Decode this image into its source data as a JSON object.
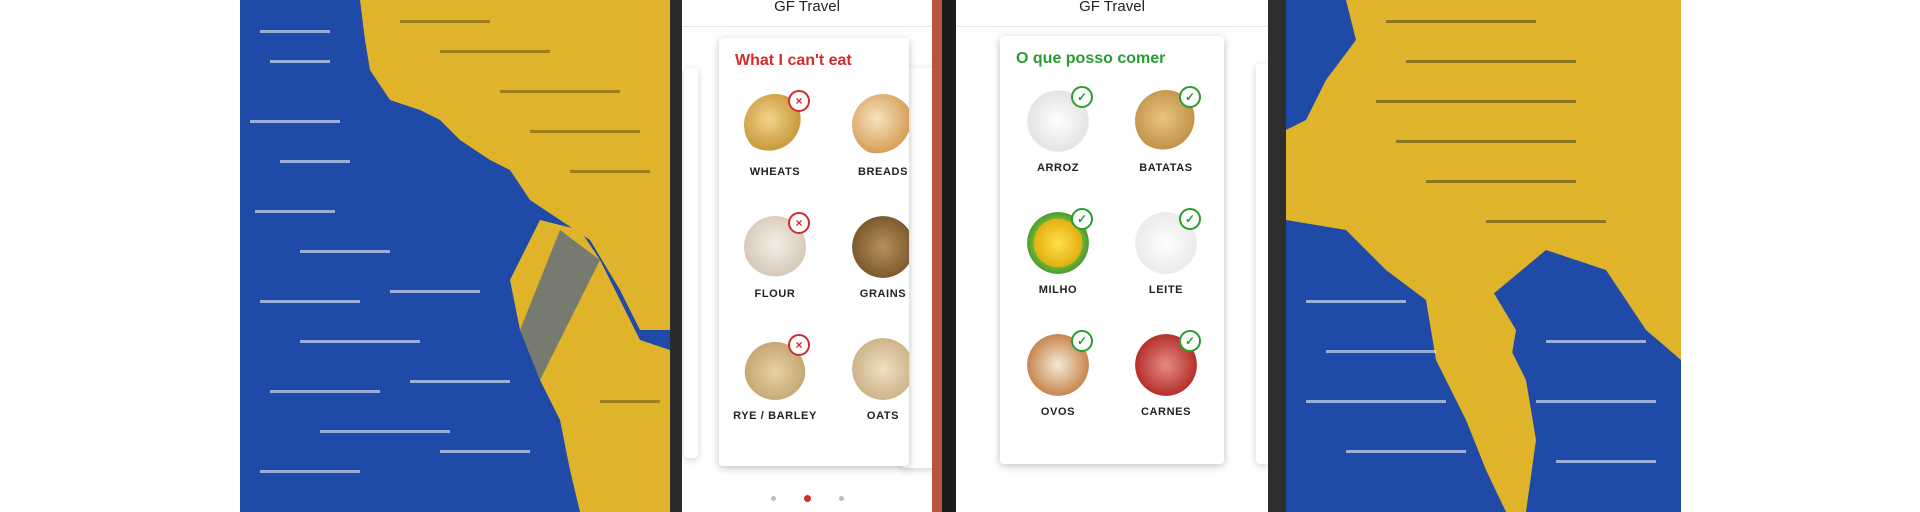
{
  "screens": [
    {
      "app_title": "GF Travel",
      "card": {
        "title": "What I can't eat",
        "accent": "#d32c2c",
        "status_icon": "close-circle-icon",
        "items": [
          {
            "label": "WHEATS",
            "icon": "wheat-icon"
          },
          {
            "label": "BREADS",
            "icon": "bread-icon"
          },
          {
            "label": "FLOUR",
            "icon": "flour-icon"
          },
          {
            "label": "GRAINS",
            "icon": "grains-icon"
          },
          {
            "label": "RYE / BARLEY",
            "icon": "barley-icon"
          },
          {
            "label": "OATS",
            "icon": "oats-icon"
          }
        ]
      },
      "pagination": {
        "count": 3,
        "active_index": 1,
        "active_color": "#d32c2c"
      }
    },
    {
      "app_title": "GF Travel",
      "card": {
        "title": "O que posso comer",
        "accent": "#2b9c30",
        "status_icon": "check-circle-icon",
        "items": [
          {
            "label": "ARROZ",
            "icon": "rice-icon"
          },
          {
            "label": "BATATAS",
            "icon": "potato-icon"
          },
          {
            "label": "MILHO",
            "icon": "corn-icon"
          },
          {
            "label": "LEITE",
            "icon": "milk-icon"
          },
          {
            "label": "OVOS",
            "icon": "eggs-icon"
          },
          {
            "label": "CARNES",
            "icon": "meat-icon"
          }
        ]
      }
    }
  ],
  "background": {
    "map_land": "#e0b42a",
    "map_sea": "#1f4aa8"
  }
}
